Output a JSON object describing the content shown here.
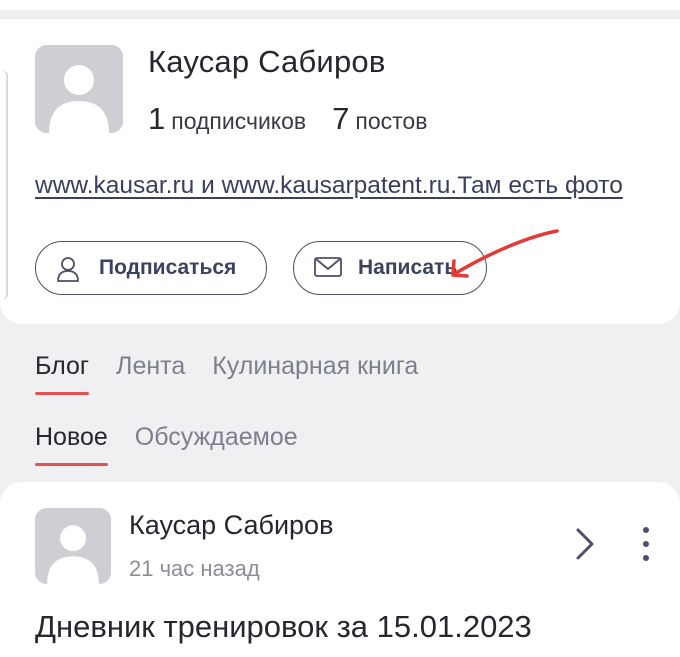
{
  "profile": {
    "name": "Каусар Сабиров",
    "subscribers_count": "1",
    "subscribers_label": "подписчиков",
    "posts_count": "7",
    "posts_label": "постов",
    "bio_link": "www.kausar.ru и www.kausarpatent.ru.Там есть фото",
    "avatar_icon": "user-silhouette-icon"
  },
  "actions": {
    "subscribe_label": "Подписаться",
    "subscribe_icon": "person-icon",
    "write_label": "Написать",
    "write_icon": "envelope-icon"
  },
  "tabs": {
    "main": [
      {
        "label": "Блог",
        "active": true
      },
      {
        "label": "Лента",
        "active": false
      },
      {
        "label": "Кулинарная книга",
        "active": false
      }
    ],
    "sub": [
      {
        "label": "Новое",
        "active": true
      },
      {
        "label": "Обсуждаемое",
        "active": false
      }
    ]
  },
  "post": {
    "author": "Каусар Сабиров",
    "time": "21 час назад",
    "title": "Дневник тренировок за 15.01.2023",
    "chevron_icon": "chevron-right-icon",
    "more_icon": "more-vertical-icon"
  },
  "colors": {
    "accent": "#e35353",
    "annotation": "#e53935",
    "button_border": "#4a4f6a",
    "background": "#f0f0f2"
  }
}
